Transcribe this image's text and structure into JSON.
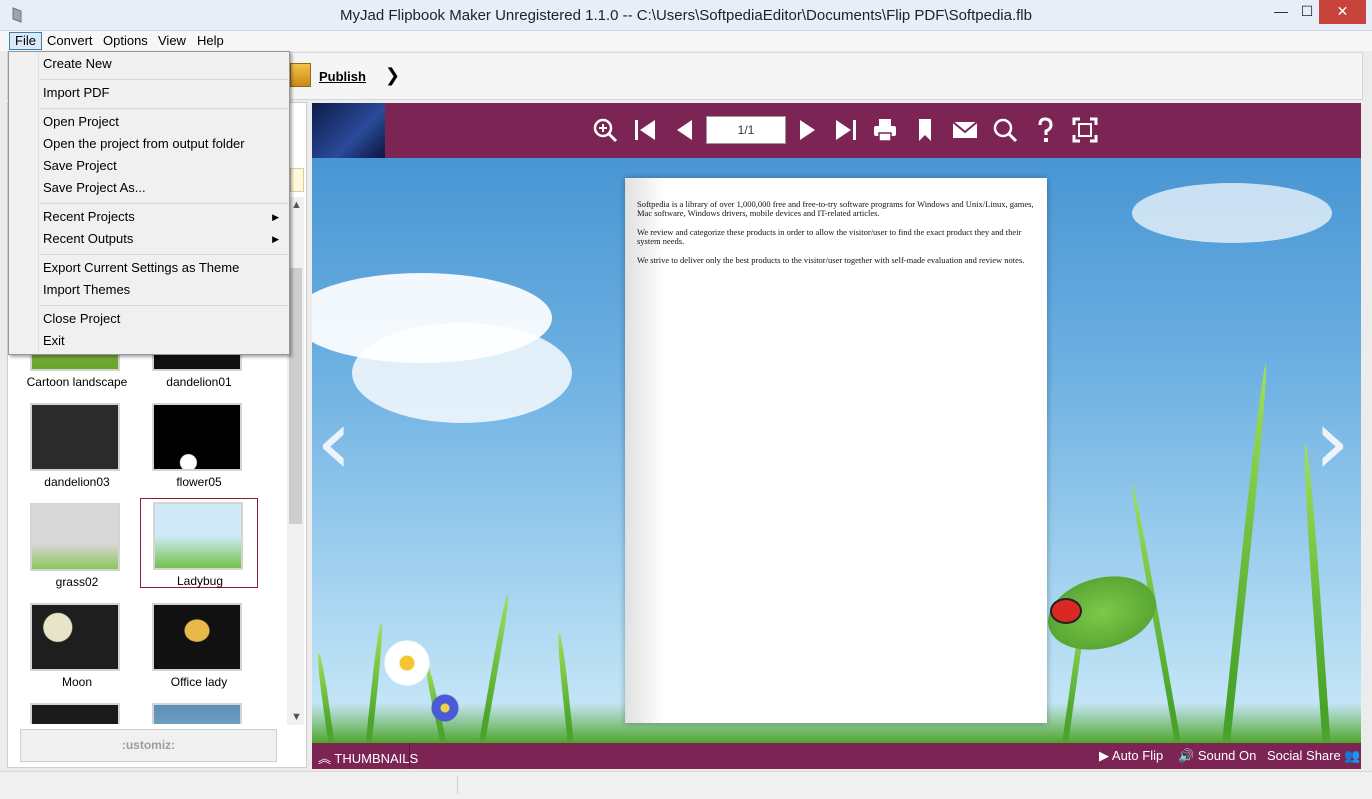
{
  "window": {
    "title": "MyJad Flipbook Maker Unregistered 1.1.0  -- C:\\Users\\SoftpediaEditor\\Documents\\Flip PDF\\Softpedia.flb",
    "minimize_glyph": "—",
    "maximize_glyph": "☐",
    "close_glyph": "✕"
  },
  "menubar": {
    "file": "File",
    "convert": "Convert",
    "options": "Options",
    "view": "View",
    "help": "Help"
  },
  "toolbar": {
    "publish": "Publish",
    "more": "❯"
  },
  "file_menu": {
    "create_new": "Create New",
    "import_pdf": "Import PDF",
    "open_project": "Open Project",
    "open_from_output": "Open the project from output folder",
    "save_project": "Save Project",
    "save_project_as": "Save Project As...",
    "recent_projects": "Recent Projects",
    "recent_outputs": "Recent Outputs",
    "export_theme": "Export Current Settings as Theme",
    "import_themes": "Import Themes",
    "close_project": "Close Project",
    "exit": "Exit",
    "submenu_arrow": "▶"
  },
  "themes": {
    "items": [
      {
        "label": "Cartoon landscape"
      },
      {
        "label": "dandelion01"
      },
      {
        "label": "dandelion03"
      },
      {
        "label": "flower05"
      },
      {
        "label": "grass02"
      },
      {
        "label": "Ladybug",
        "selected": true
      },
      {
        "label": "Moon"
      },
      {
        "label": "Office lady"
      }
    ],
    "customize": ":ustomiz:"
  },
  "viewer": {
    "page_indicator": "1/1",
    "prev_page_arrow": "‹",
    "next_page_arrow": "›",
    "page_text": [
      "Softpedia is a library of over 1,000,000 free and free-to-try software programs for Windows and Unix/Linux, games, Mac software, Windows drivers, mobile devices and IT-related articles.",
      "We review and categorize these products in order to allow the visitor/user to find the exact product they and their system needs.",
      "We strive to deliver only the best products to the visitor/user together with self-made evaluation and review notes."
    ],
    "footer": {
      "thumbnails": "THUMBNAILS",
      "auto_flip": "Auto Flip",
      "sound_on": "Sound On",
      "social_share": "Social Share"
    }
  },
  "colors": {
    "accent": "#7c2454",
    "selection": "#8a1d2b"
  }
}
